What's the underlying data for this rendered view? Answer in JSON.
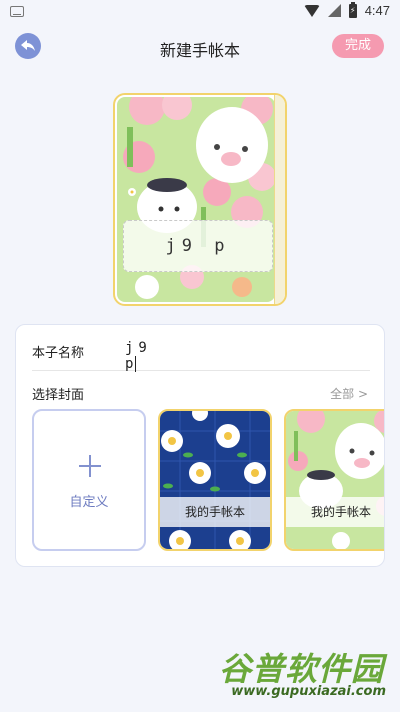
{
  "status_bar": {
    "time": "4:47",
    "battery_symbol": "⚡"
  },
  "header": {
    "title": "新建手帐本",
    "done_label": "完成"
  },
  "preview": {
    "cover_text": "j9 p"
  },
  "form": {
    "name_label": "本子名称",
    "name_value": "j9 p",
    "cover_label": "选择封面",
    "all_label": "全部 >"
  },
  "covers": {
    "custom_label": "自定义",
    "items": [
      {
        "label": "我的手帐本",
        "style": "blue-flowers"
      },
      {
        "label": "我的手帐本",
        "style": "green-bunny"
      }
    ]
  },
  "watermark": {
    "title": "谷普软件园",
    "url": "www.gupuxiazai.com"
  },
  "colors": {
    "accent": "#7e92d6",
    "done": "#f59ab0",
    "cover_border": "#f2d36c"
  }
}
